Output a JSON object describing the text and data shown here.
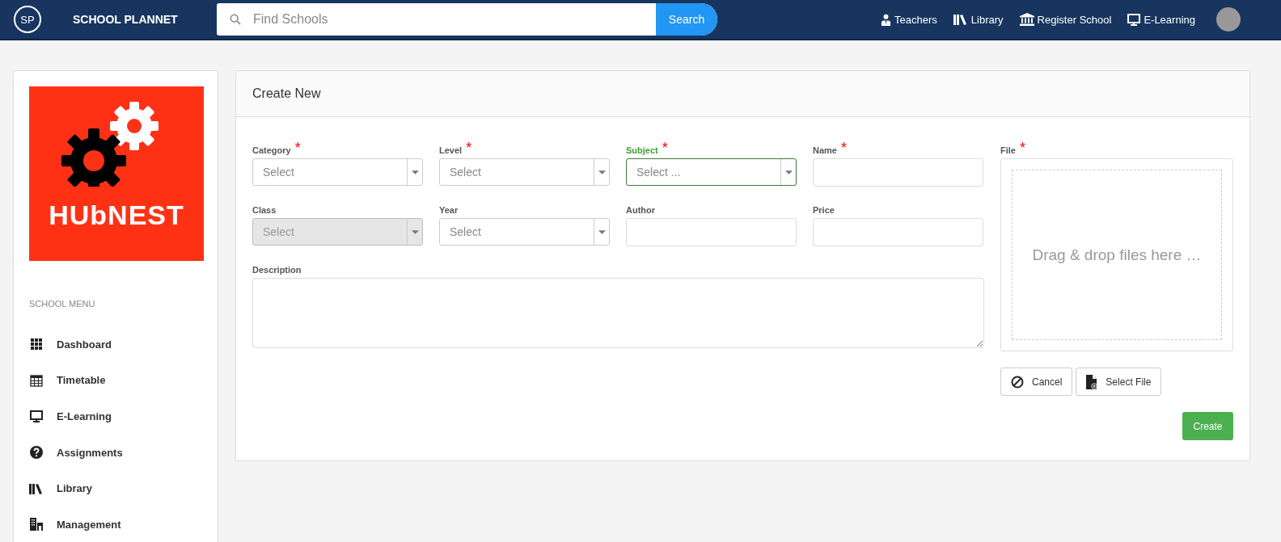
{
  "navbar": {
    "logo": "SP",
    "brand": "SCHOOL PLANNET",
    "search": {
      "placeholder": "Find Schools",
      "button": "Search"
    },
    "links": [
      {
        "label": "Teachers"
      },
      {
        "label": "Library"
      },
      {
        "label": "Register School"
      },
      {
        "label": "E-Learning"
      }
    ]
  },
  "sidebar": {
    "logo_text": "HUbNEST",
    "menu_title": "SCHOOL MENU",
    "items": [
      {
        "label": "Dashboard"
      },
      {
        "label": "Timetable"
      },
      {
        "label": "E-Learning"
      },
      {
        "label": "Assignments"
      },
      {
        "label": "Library"
      },
      {
        "label": "Management"
      }
    ]
  },
  "form": {
    "title": "Create New",
    "fields": [
      {
        "label": "Category",
        "required_mark": "*",
        "kind": "select",
        "placeholder": "Select",
        "focused": false,
        "disabled": false
      },
      {
        "label": "Level",
        "required_mark": "*",
        "kind": "select",
        "placeholder": "Select",
        "focused": false,
        "disabled": false
      },
      {
        "label": "Subject",
        "required_mark": "*",
        "kind": "select",
        "placeholder": "Select ...",
        "focused": true,
        "disabled": false
      },
      {
        "label": "Name",
        "required_mark": "*",
        "kind": "text",
        "focused": false,
        "disabled": false
      },
      {
        "label": "Class",
        "kind": "select",
        "placeholder": "Select",
        "focused": false,
        "disabled": true
      },
      {
        "label": "Year",
        "kind": "select",
        "placeholder": "Select",
        "focused": false,
        "disabled": false
      },
      {
        "label": "Author",
        "kind": "text",
        "focused": false,
        "disabled": false
      },
      {
        "label": "Price",
        "kind": "text",
        "focused": false,
        "disabled": false
      }
    ],
    "description": {
      "label": "Description"
    },
    "file": {
      "label": "File",
      "required_mark": "*",
      "dropzone": "Drag & drop files here …",
      "cancel": "Cancel",
      "select": "Select File"
    },
    "submit": "Create"
  }
}
